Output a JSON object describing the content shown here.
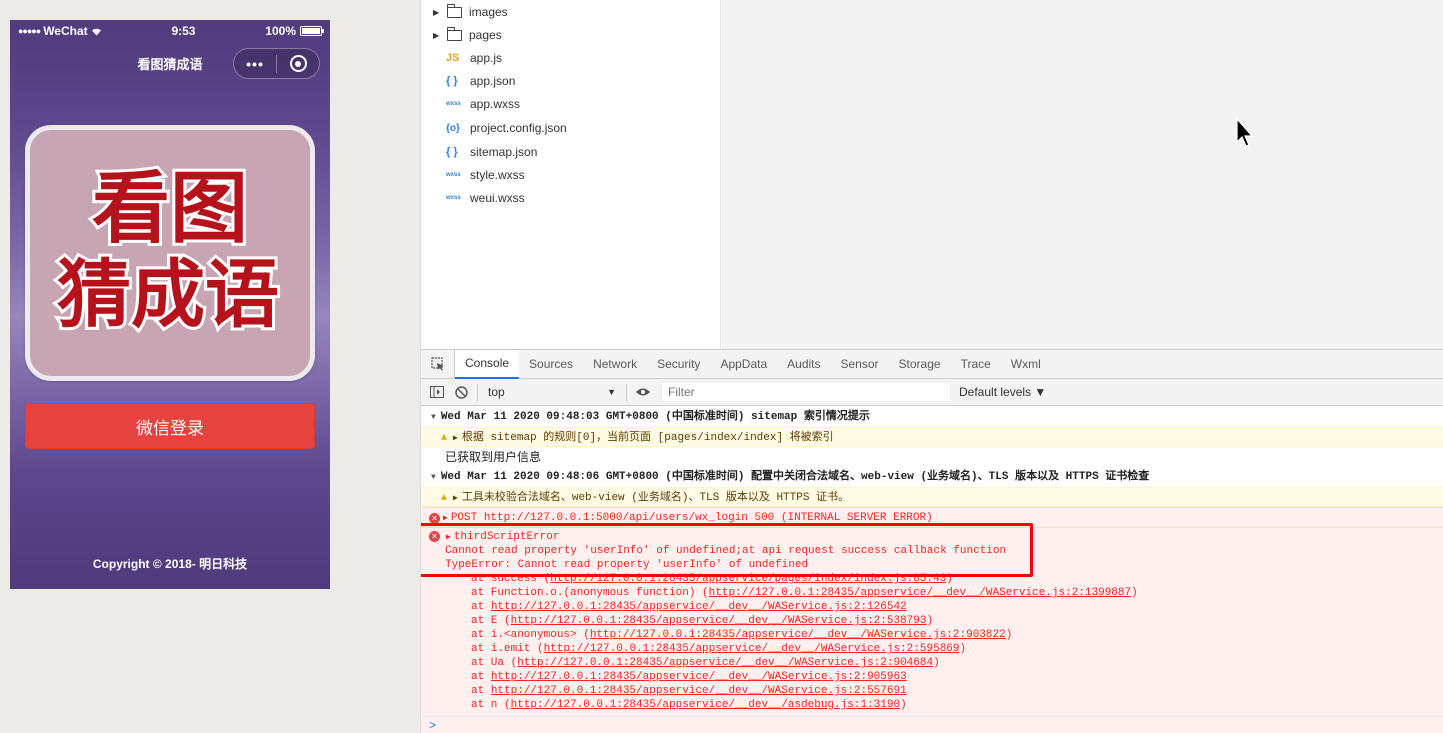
{
  "phone": {
    "status": {
      "carrier": "WeChat",
      "time": "9:53",
      "battery": "100%"
    },
    "navbar": {
      "title": "看图猜成语",
      "more": "•••"
    },
    "logo": {
      "line1": "看图",
      "line2": "猜成语"
    },
    "login_button": "微信登录",
    "copyright": "Copyright © 2018- 明日科技"
  },
  "files": [
    {
      "type": "folder",
      "name": "images"
    },
    {
      "type": "folder",
      "name": "pages"
    },
    {
      "type": "js",
      "icon": "JS",
      "name": "app.js"
    },
    {
      "type": "json",
      "icon": "{ }",
      "name": "app.json"
    },
    {
      "type": "wxss",
      "icon": "wxss",
      "name": "app.wxss"
    },
    {
      "type": "cfg",
      "icon": "{o}",
      "name": "project.config.json"
    },
    {
      "type": "json",
      "icon": "{ }",
      "name": "sitemap.json"
    },
    {
      "type": "wxss",
      "icon": "wxss",
      "name": "style.wxss"
    },
    {
      "type": "wxss",
      "icon": "wxss",
      "name": "weui.wxss"
    }
  ],
  "devtools": {
    "tabs": [
      "Console",
      "Sources",
      "Network",
      "Security",
      "AppData",
      "Audits",
      "Sensor",
      "Storage",
      "Trace",
      "Wxml"
    ],
    "active_tab": "Console",
    "context": "top",
    "filter_placeholder": "Filter",
    "levels": "Default levels ▼"
  },
  "console": {
    "group1": "Wed Mar 11 2020 09:48:03 GMT+0800 (中国标准时间) sitemap 索引情况提示",
    "warn1": "根据 sitemap 的规则[0]，当前页面 [pages/index/index] 将被索引",
    "info1": "已获取到用户信息",
    "group2": "Wed Mar 11 2020 09:48:06 GMT+0800 (中国标准时间) 配置中关闭合法域名、web-view (业务域名)、TLS 版本以及 HTTPS 证书检查",
    "warn2": "工具未校验合法域名、web-view (业务域名)、TLS 版本以及 HTTPS 证书。",
    "error1": "POST http://127.0.0.1:5000/api/users/wx_login 500 (INTERNAL SERVER ERROR)",
    "error2_title": "thirdScriptError",
    "error2_line1": "Cannot read property 'userInfo' of undefined;at api request success callback function",
    "error2_line2": "TypeError: Cannot read property 'userInfo' of undefined",
    "stack": [
      {
        "prefix": "at success (",
        "link": "http://127.0.0.1:28435/appservice/pages/index/index.js:85:43",
        "suffix": ")"
      },
      {
        "prefix": "at Function.o.(anonymous function) (",
        "link": "http://127.0.0.1:28435/appservice/__dev__/WAService.js:2:1399887",
        "suffix": ")"
      },
      {
        "prefix": "at ",
        "link": "http://127.0.0.1:28435/appservice/__dev__/WAService.js:2:126542",
        "suffix": ""
      },
      {
        "prefix": "at E (",
        "link": "http://127.0.0.1:28435/appservice/__dev__/WAService.js:2:538793",
        "suffix": ")"
      },
      {
        "prefix": "at i.<anonymous> (",
        "link": "http://127.0.0.1:28435/appservice/__dev__/WAService.js:2:903822",
        "suffix": ")"
      },
      {
        "prefix": "at i.emit (",
        "link": "http://127.0.0.1:28435/appservice/__dev__/WAService.js:2:595869",
        "suffix": ")"
      },
      {
        "prefix": "at Ua (",
        "link": "http://127.0.0.1:28435/appservice/__dev__/WAService.js:2:904684",
        "suffix": ")"
      },
      {
        "prefix": "at ",
        "link": "http://127.0.0.1:28435/appservice/__dev__/WAService.js:2:905963",
        "suffix": ""
      },
      {
        "prefix": "at ",
        "link": "http://127.0.0.1:28435/appservice/__dev__/WAService.js:2:557691",
        "suffix": ""
      },
      {
        "prefix": "at n (",
        "link": "http://127.0.0.1:28435/appservice/__dev__/asdebug.js:1:3190",
        "suffix": ")"
      }
    ],
    "prompt": ">"
  },
  "colors": {
    "error": "#fe2424",
    "warn_bg": "#fffbe5",
    "login_button": "#e64340",
    "highlight": "#ff0000"
  }
}
